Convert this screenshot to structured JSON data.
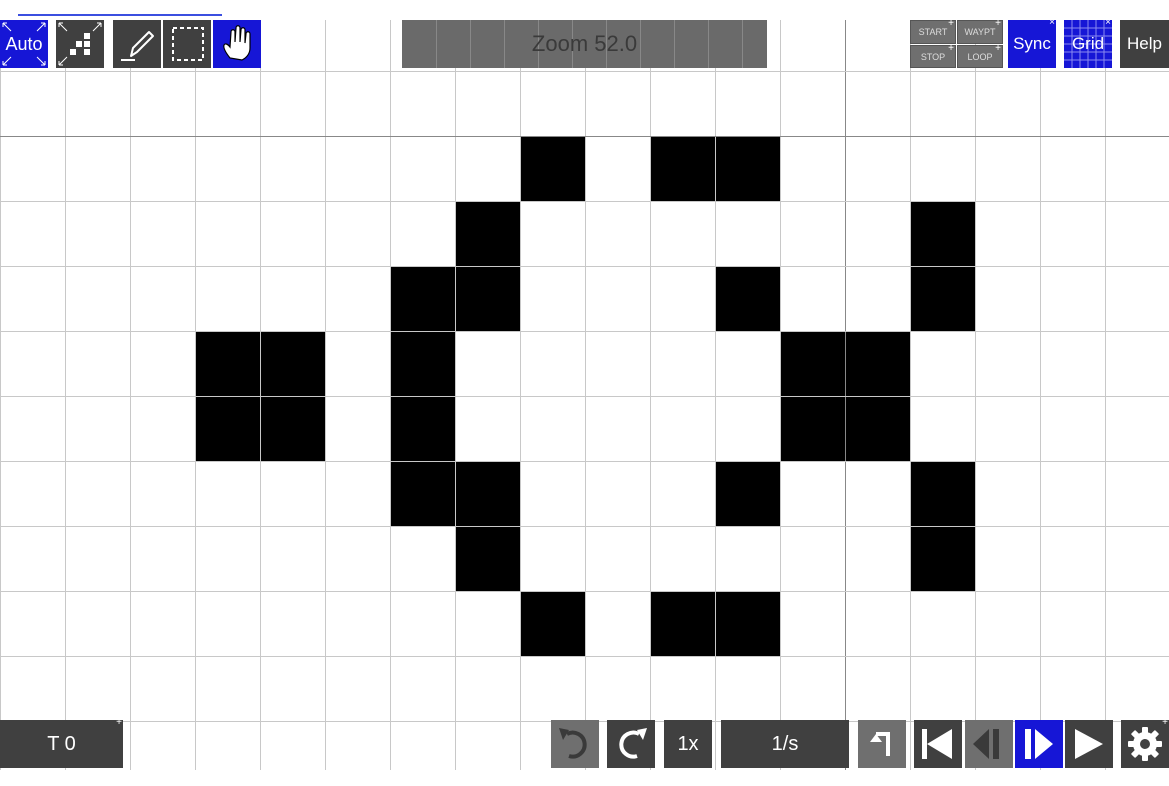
{
  "toolbar": {
    "auto_label": "Auto",
    "zoom_label": "Zoom 52.0",
    "start_label": "START",
    "waypt_label": "WAYPT",
    "stop_label": "STOP",
    "loop_label": "LOOP",
    "sync_label": "Sync",
    "grid_label": "Grid",
    "help_label": "Help"
  },
  "bottombar": {
    "generation_label": "T 0",
    "speed_multiplier_label": "1x",
    "rate_label": "1/s"
  },
  "icons": {
    "fit": "fit-pattern-icon",
    "pencil": "pencil-icon",
    "select": "select-icon",
    "pan": "hand-icon",
    "undo": "undo-icon",
    "redo": "redo-icon",
    "reset": "reset-icon",
    "first": "skip-to-start-icon",
    "step_back": "step-back-icon",
    "step_forward": "step-forward-icon",
    "play": "play-icon",
    "settings": "gear-icon"
  },
  "colors": {
    "active_blue": "#1616d6",
    "button_dark": "#404040",
    "live_cell": "#000000",
    "grid_line": "#c8c8c8"
  },
  "cells": {
    "live": [
      [
        8,
        2
      ],
      [
        10,
        2
      ],
      [
        11,
        2
      ],
      [
        7,
        3
      ],
      [
        14,
        3
      ],
      [
        6,
        4
      ],
      [
        7,
        4
      ],
      [
        11,
        4
      ],
      [
        14,
        4
      ],
      [
        3,
        5
      ],
      [
        4,
        5
      ],
      [
        6,
        5
      ],
      [
        12,
        5
      ],
      [
        13,
        5
      ],
      [
        3,
        6
      ],
      [
        4,
        6
      ],
      [
        6,
        6
      ],
      [
        12,
        6
      ],
      [
        13,
        6
      ],
      [
        6,
        7
      ],
      [
        7,
        7
      ],
      [
        11,
        7
      ],
      [
        14,
        7
      ],
      [
        7,
        8
      ],
      [
        14,
        8
      ],
      [
        8,
        9
      ],
      [
        10,
        9
      ],
      [
        11,
        9
      ]
    ]
  }
}
